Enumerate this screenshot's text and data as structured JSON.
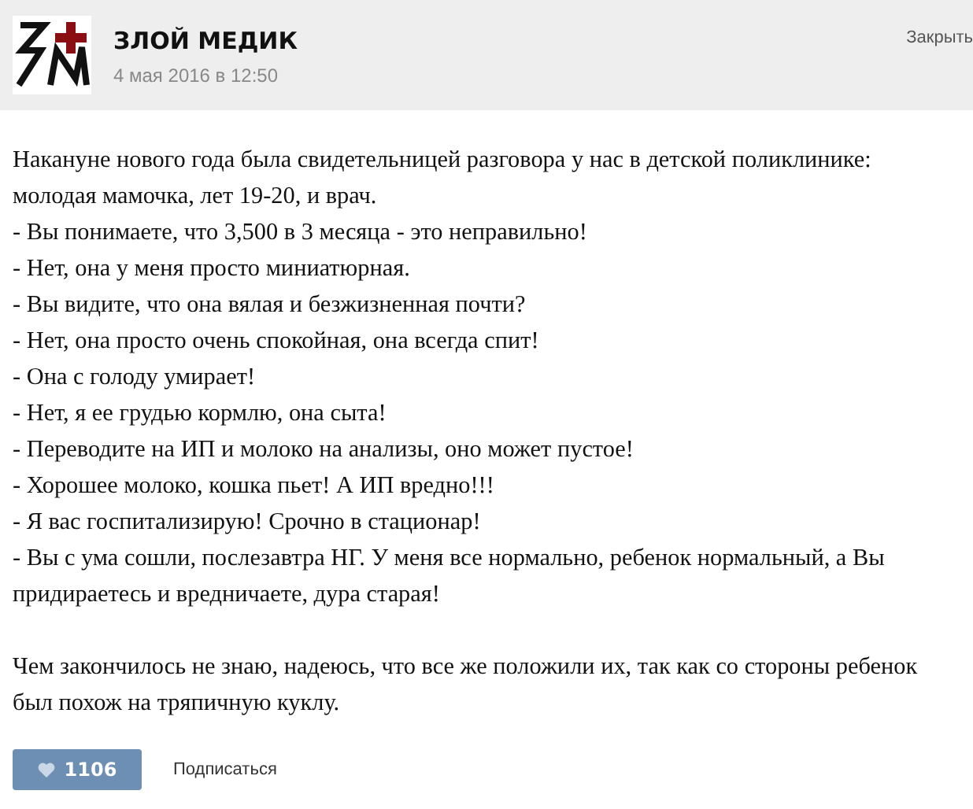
{
  "post": {
    "author": "ЗЛОЙ МЕДИК",
    "date": "4 мая 2016 в 12:50",
    "close": "Закрыть",
    "paragraphs": [
      [
        "Накануне нового года была свидетельницей разговора у нас в детской поликлинике: молодая мамочка, лет 19-20, и врач.",
        "- Вы понимаете, что 3,500 в 3 месяца - это неправильно!",
        "- Нет, она у меня просто миниатюрная.",
        "- Вы видите, что она вялая и безжизненная почти?",
        "- Нет, она просто очень спокойная, она всегда спит!",
        "- Она с голоду умирает!",
        "- Нет, я ее грудью кормлю, она сыта!",
        "- Переводите на ИП и молоко на анализы, оно может пустое!",
        "- Хорошее молоко, кошка пьет! А ИП вредно!!!",
        "- Я вас госпитализирую! Срочно в стационар!",
        "- Вы с ума сошли, послезавтра НГ. У меня все нормально, ребенок нормальный, а Вы придираетесь и вредничаете, дура старая!"
      ],
      [
        "Чем закончилось не знаю, надеюсь, что все же положили их, так как со стороны ребенок был похож на тряпичную куклу."
      ]
    ],
    "likes": "1106",
    "subscribe": "Подписаться"
  }
}
